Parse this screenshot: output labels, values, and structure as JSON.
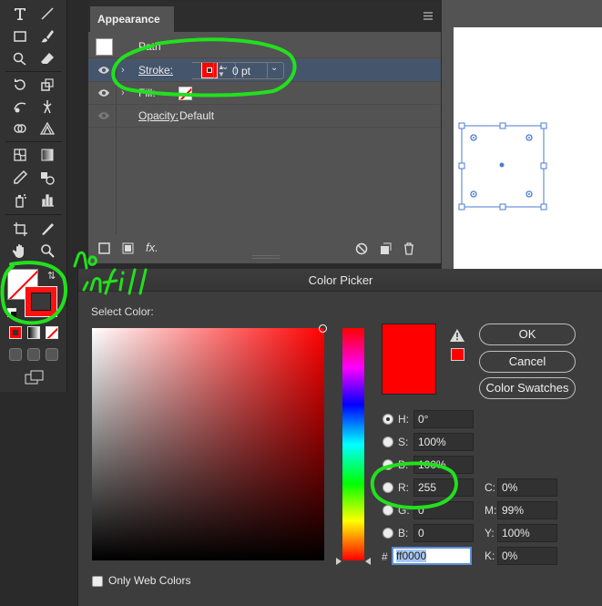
{
  "appearance_panel": {
    "tab_title": "Appearance",
    "rows": {
      "path_label": "Path",
      "stroke_label": "Stroke:",
      "stroke_weight": "0 pt",
      "fill_label": "Fill:",
      "opacity_label": "Opacity:",
      "opacity_value": "Default"
    },
    "footer_icons": [
      "new-stroke-icon",
      "new-fill-icon",
      "fx-icon",
      "clear-appearance-icon",
      "duplicate-item-icon",
      "delete-item-icon"
    ],
    "fx_label": "fx."
  },
  "tools_panel": {
    "fill_swatch": "none",
    "stroke_swatch": "#3a3a3a"
  },
  "color_picker": {
    "title": "Color Picker",
    "select_color_label": "Select Color:",
    "buttons": {
      "ok": "OK",
      "cancel": "Cancel",
      "color_swatches": "Color Swatches"
    },
    "hsb": {
      "h_label": "H:",
      "h_value": "0°",
      "s_label": "S:",
      "s_value": "100%",
      "b_label": "B:",
      "b_value": "100%"
    },
    "rgb": {
      "r_label": "R:",
      "r_value": "255",
      "g_label": "G:",
      "g_value": "0",
      "b_label": "B:",
      "b_value": "0"
    },
    "cmyk": {
      "c_label": "C:",
      "c_value": "0%",
      "m_label": "M:",
      "m_value": "99%",
      "y_label": "Y:",
      "y_value": "100%",
      "k_label": "K:",
      "k_value": "0%"
    },
    "hex_hash": "#",
    "hex_value": "ff0000",
    "only_web_colors_label": "Only Web Colors",
    "selected_color": "#ff0000"
  },
  "annotations": {
    "note_text": "no infill"
  },
  "colors": {
    "accent_selection": "#45566c",
    "stroke_red": "#ff0000",
    "annotation_green": "#22e01d",
    "bounding_box_blue": "#4a7bd4"
  }
}
